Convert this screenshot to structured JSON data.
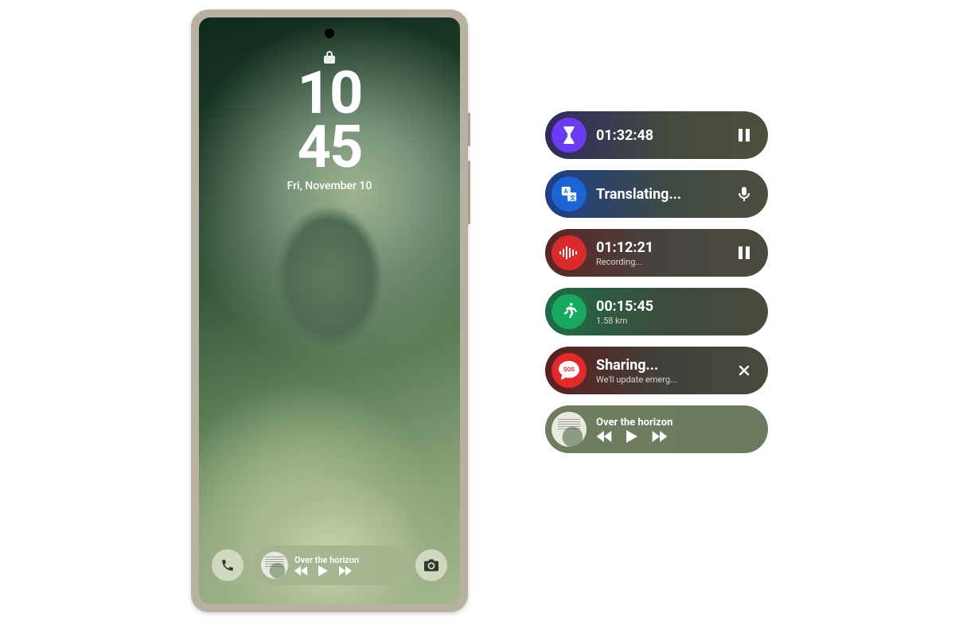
{
  "phone": {
    "clock": {
      "hour": "10",
      "minute": "45",
      "date": "Fri, November 10"
    },
    "dock": {
      "media": {
        "title": "Over the horizon"
      }
    }
  },
  "pills": {
    "stopwatch": {
      "time": "01:32:48"
    },
    "translate": {
      "label": "Translating..."
    },
    "recording": {
      "time": "01:12:21",
      "status": "Recording..."
    },
    "run": {
      "time": "00:15:45",
      "distance": "1.58 km"
    },
    "sos": {
      "title": "Sharing...",
      "subtitle": "We'll update emerg..."
    },
    "music": {
      "title": "Over the horizon"
    }
  }
}
